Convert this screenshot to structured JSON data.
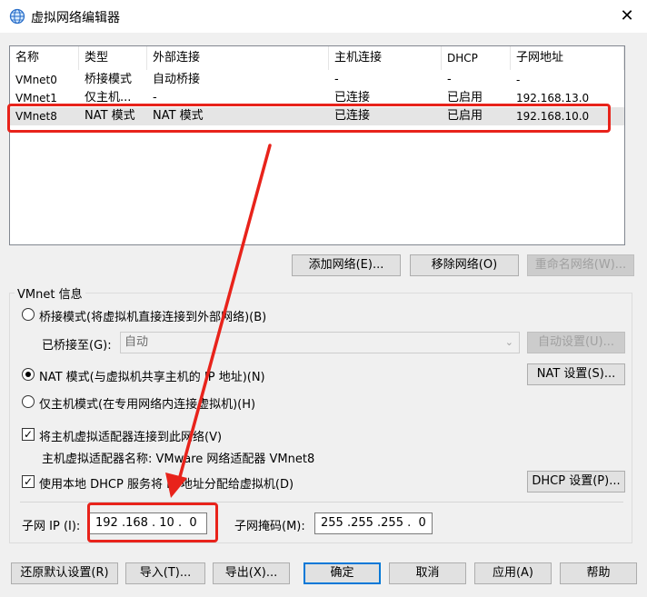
{
  "window": {
    "title": "虚拟网络编辑器",
    "close_glyph": "✕"
  },
  "network_list": {
    "columns": [
      "名称",
      "类型",
      "外部连接",
      "主机连接",
      "DHCP",
      "子网地址"
    ],
    "rows": [
      [
        "VMnet0",
        "桥接模式",
        "自动桥接",
        "-",
        "-",
        "-"
      ],
      [
        "VMnet1",
        "仅主机...",
        "-",
        "已连接",
        "已启用",
        "192.168.13.0"
      ],
      [
        "VMnet8",
        "NAT 模式",
        "NAT 模式",
        "已连接",
        "已启用",
        "192.168.10.0"
      ]
    ],
    "selected_row": 2
  },
  "list_buttons": {
    "add": "添加网络(E)...",
    "remove": "移除网络(O)",
    "rename": "重命名网络(W)..."
  },
  "vmnet_info": {
    "group_label": "VMnet 信息",
    "bridged_option": "桥接模式(将虚拟机直接连接到外部网络)(B)",
    "bridged_to_label": "已桥接至(G):",
    "bridged_to_value": "自动",
    "auto_settings": "自动设置(U)...",
    "nat_option": "NAT 模式(与虚拟机共享主机的 IP 地址)(N)",
    "nat_settings": "NAT 设置(S)...",
    "host_only_option": "仅主机模式(在专用网络内连接虚拟机)(H)",
    "selected_mode": "nat",
    "connect_adapter_label": "将主机虚拟适配器连接到此网络(V)",
    "connect_adapter_checked": true,
    "adapter_name": "主机虚拟适配器名称: VMware 网络适配器 VMnet8",
    "use_dhcp_label": "使用本地 DHCP 服务将 IP 地址分配给虚拟机(D)",
    "use_dhcp_checked": true,
    "dhcp_settings": "DHCP 设置(P)...",
    "subnet_ip_label": "子网 IP (I):",
    "subnet_ip_value": "192 .168 . 10 .  0",
    "subnet_mask_label": "子网掩码(M):",
    "subnet_mask_value": "255 .255 .255 .  0"
  },
  "footer_buttons": {
    "restore": "还原默认设置(R)",
    "import": "导入(T)...",
    "export": "导出(X)...",
    "ok": "确定",
    "cancel": "取消",
    "apply": "应用(A)",
    "help": "帮助"
  },
  "colors": {
    "annotation": "#e8231b",
    "accent": "#0078d7"
  },
  "check_glyph": "✓",
  "combo_arrow_glyph": "⌄"
}
